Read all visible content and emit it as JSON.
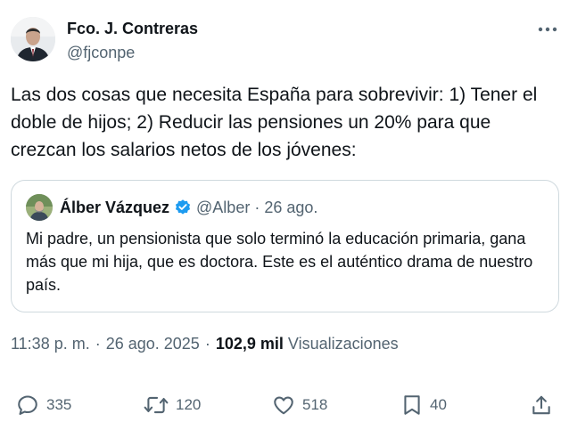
{
  "author": {
    "name": "Fco. J. Contreras",
    "handle": "@fjconpe"
  },
  "tweet_text": "Las dos cosas que necesita España para sobrevivir: 1) Tener el doble de hijos; 2) Reducir las pensiones un 20% para que crezcan los salarios netos de los jóvenes:",
  "quote": {
    "name": "Álber Vázquez",
    "handle": "@Alber",
    "separator": "·",
    "date": "26 ago.",
    "text": "Mi padre, un pensionista que solo terminó la educación primaria, gana más que mi hija, que es doctora. Este es el auténtico drama de nuestro país.",
    "verified_color": "#1d9bf0"
  },
  "meta": {
    "time": "11:38 p. m.",
    "separator": "·",
    "date": "26 ago. 2025",
    "views_count": "102,9 mil",
    "views_label": "Visualizaciones"
  },
  "actions": [
    {
      "icon": "reply-icon",
      "count": "335"
    },
    {
      "icon": "retweet-icon",
      "count": "120"
    },
    {
      "icon": "like-icon",
      "count": "518"
    },
    {
      "icon": "bookmark-icon",
      "count": "40"
    },
    {
      "icon": "share-icon",
      "count": ""
    }
  ],
  "colors": {
    "text": "#0f1419",
    "secondary": "#536471",
    "border": "#cfd9de"
  }
}
